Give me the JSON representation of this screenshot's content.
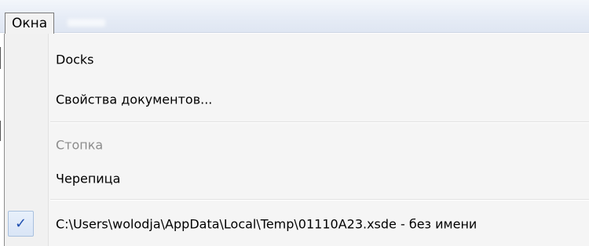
{
  "menubar": {
    "menu_label": "Окна"
  },
  "menu": {
    "items": [
      {
        "label": "Docks",
        "enabled": true,
        "checked": false
      },
      {
        "label": "Свойства документов...",
        "enabled": true,
        "checked": false
      },
      {
        "label": "Стопка",
        "enabled": false,
        "checked": false
      },
      {
        "label": "Черепица",
        "enabled": true,
        "checked": false
      },
      {
        "label": "C:\\Users\\wolodja\\AppData\\Local\\Temp\\01110A23.xsde - без имени",
        "enabled": true,
        "checked": true
      }
    ]
  },
  "colors": {
    "menubar_bg": "#e6ecf6",
    "dropdown_bg": "#f5f5f5",
    "disabled_text": "#8c8c8c",
    "check_color": "#1e4fb0"
  },
  "icons": {
    "checkmark": "check-icon"
  }
}
